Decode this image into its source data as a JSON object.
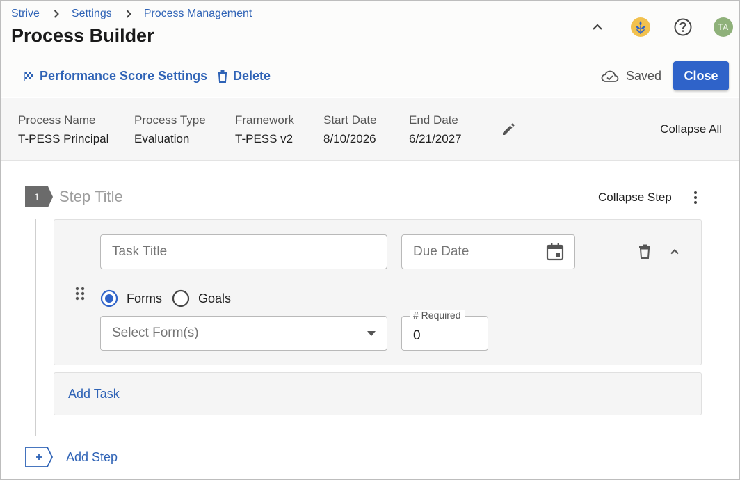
{
  "breadcrumb": [
    "Strive",
    "Settings",
    "Process Management"
  ],
  "page_title": "Process Builder",
  "header_icons": [
    "chevron-up-icon",
    "wheat-logo-icon",
    "help-icon"
  ],
  "user": {
    "initials": "TA"
  },
  "toolbar": {
    "performance_label": "Performance Score Settings",
    "delete_label": "Delete",
    "saved_label": "Saved",
    "close_label": "Close"
  },
  "info": [
    {
      "label": "Process Name",
      "value": "T-PESS Principal"
    },
    {
      "label": "Process Type",
      "value": "Evaluation"
    },
    {
      "label": "Framework",
      "value": "T-PESS v2"
    },
    {
      "label": "Start Date",
      "value": "8/10/2026"
    },
    {
      "label": "End Date",
      "value": "6/21/2027"
    }
  ],
  "collapse_all_label": "Collapse All",
  "step": {
    "number": "1",
    "title_placeholder": "Step Title",
    "collapse_label": "Collapse Step"
  },
  "task": {
    "title_placeholder": "Task Title",
    "due_date_placeholder": "Due Date",
    "radio_forms": "Forms",
    "radio_goals": "Goals",
    "selected_radio": "Forms",
    "select_placeholder": "Select Form(s)",
    "required_label": "# Required",
    "required_value": "0"
  },
  "add_task_label": "Add Task",
  "add_step_label": "Add Step",
  "colors": {
    "link": "#2f63b6",
    "primary_button": "#2f63c9",
    "avatar": "#8fb17a",
    "step_badge": "#6b6b6b"
  }
}
